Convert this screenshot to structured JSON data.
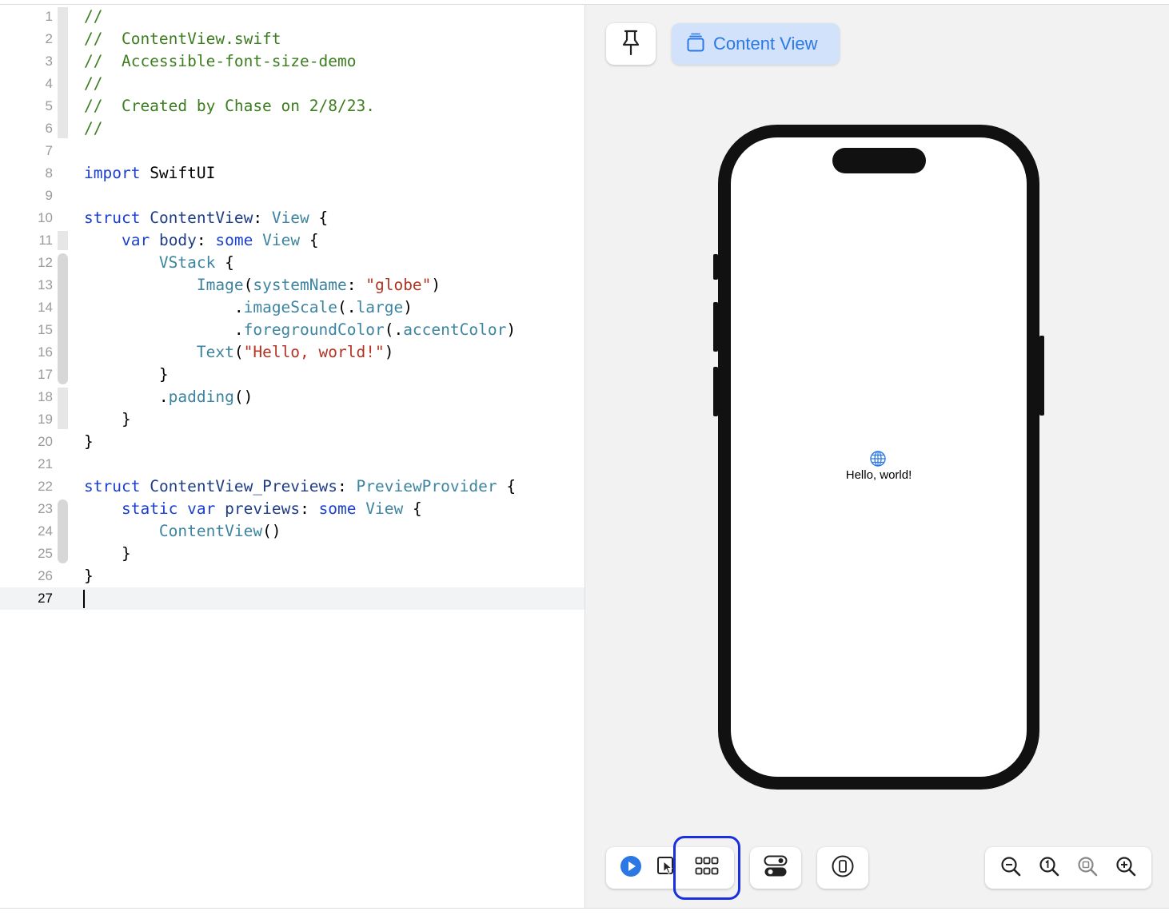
{
  "editor": {
    "lines": [
      {
        "num": "1",
        "tokens": [
          {
            "t": "//",
            "c": "comment"
          }
        ]
      },
      {
        "num": "2",
        "tokens": [
          {
            "t": "//  ContentView.swift",
            "c": "comment"
          }
        ]
      },
      {
        "num": "3",
        "tokens": [
          {
            "t": "//  Accessible-font-size-demo",
            "c": "comment"
          }
        ]
      },
      {
        "num": "4",
        "tokens": [
          {
            "t": "//",
            "c": "comment"
          }
        ]
      },
      {
        "num": "5",
        "tokens": [
          {
            "t": "//  Created by Chase on 2/8/23.",
            "c": "comment"
          }
        ]
      },
      {
        "num": "6",
        "tokens": [
          {
            "t": "//",
            "c": "comment"
          }
        ]
      },
      {
        "num": "7",
        "tokens": []
      },
      {
        "num": "8",
        "tokens": [
          {
            "t": "import",
            "c": "keyword"
          },
          {
            "t": " SwiftUI",
            "c": "plain"
          }
        ]
      },
      {
        "num": "9",
        "tokens": []
      },
      {
        "num": "10",
        "tokens": [
          {
            "t": "struct",
            "c": "keyword"
          },
          {
            "t": " ",
            "c": "plain"
          },
          {
            "t": "ContentView",
            "c": "decl"
          },
          {
            "t": ": ",
            "c": "plain"
          },
          {
            "t": "View",
            "c": "type"
          },
          {
            "t": " {",
            "c": "plain"
          }
        ]
      },
      {
        "num": "11",
        "tokens": [
          {
            "t": "    ",
            "c": "plain"
          },
          {
            "t": "var",
            "c": "keyword"
          },
          {
            "t": " ",
            "c": "plain"
          },
          {
            "t": "body",
            "c": "decl"
          },
          {
            "t": ": ",
            "c": "plain"
          },
          {
            "t": "some",
            "c": "keyword"
          },
          {
            "t": " ",
            "c": "plain"
          },
          {
            "t": "View",
            "c": "type"
          },
          {
            "t": " {",
            "c": "plain"
          }
        ]
      },
      {
        "num": "12",
        "tokens": [
          {
            "t": "        ",
            "c": "plain"
          },
          {
            "t": "VStack",
            "c": "type"
          },
          {
            "t": " {",
            "c": "plain"
          }
        ]
      },
      {
        "num": "13",
        "tokens": [
          {
            "t": "            ",
            "c": "plain"
          },
          {
            "t": "Image",
            "c": "type"
          },
          {
            "t": "(",
            "c": "plain"
          },
          {
            "t": "systemName",
            "c": "member"
          },
          {
            "t": ": ",
            "c": "plain"
          },
          {
            "t": "\"globe\"",
            "c": "string"
          },
          {
            "t": ")",
            "c": "plain"
          }
        ]
      },
      {
        "num": "14",
        "tokens": [
          {
            "t": "                .",
            "c": "plain"
          },
          {
            "t": "imageScale",
            "c": "member"
          },
          {
            "t": "(.",
            "c": "plain"
          },
          {
            "t": "large",
            "c": "member"
          },
          {
            "t": ")",
            "c": "plain"
          }
        ]
      },
      {
        "num": "15",
        "tokens": [
          {
            "t": "                .",
            "c": "plain"
          },
          {
            "t": "foregroundColor",
            "c": "member"
          },
          {
            "t": "(.",
            "c": "plain"
          },
          {
            "t": "accentColor",
            "c": "member"
          },
          {
            "t": ")",
            "c": "plain"
          }
        ]
      },
      {
        "num": "16",
        "tokens": [
          {
            "t": "            ",
            "c": "plain"
          },
          {
            "t": "Text",
            "c": "type"
          },
          {
            "t": "(",
            "c": "plain"
          },
          {
            "t": "\"Hello, world!\"",
            "c": "string"
          },
          {
            "t": ")",
            "c": "plain"
          }
        ]
      },
      {
        "num": "17",
        "tokens": [
          {
            "t": "        }",
            "c": "plain"
          }
        ]
      },
      {
        "num": "18",
        "tokens": [
          {
            "t": "        .",
            "c": "plain"
          },
          {
            "t": "padding",
            "c": "member"
          },
          {
            "t": "()",
            "c": "plain"
          }
        ]
      },
      {
        "num": "19",
        "tokens": [
          {
            "t": "    }",
            "c": "plain"
          }
        ]
      },
      {
        "num": "20",
        "tokens": [
          {
            "t": "}",
            "c": "plain"
          }
        ]
      },
      {
        "num": "21",
        "tokens": []
      },
      {
        "num": "22",
        "tokens": [
          {
            "t": "struct",
            "c": "keyword"
          },
          {
            "t": " ",
            "c": "plain"
          },
          {
            "t": "ContentView_Previews",
            "c": "decl"
          },
          {
            "t": ": ",
            "c": "plain"
          },
          {
            "t": "PreviewProvider",
            "c": "type"
          },
          {
            "t": " {",
            "c": "plain"
          }
        ]
      },
      {
        "num": "23",
        "tokens": [
          {
            "t": "    ",
            "c": "plain"
          },
          {
            "t": "static",
            "c": "keyword"
          },
          {
            "t": " ",
            "c": "plain"
          },
          {
            "t": "var",
            "c": "keyword"
          },
          {
            "t": " ",
            "c": "plain"
          },
          {
            "t": "previews",
            "c": "decl"
          },
          {
            "t": ": ",
            "c": "plain"
          },
          {
            "t": "some",
            "c": "keyword"
          },
          {
            "t": " ",
            "c": "plain"
          },
          {
            "t": "View",
            "c": "type"
          },
          {
            "t": " {",
            "c": "plain"
          }
        ]
      },
      {
        "num": "24",
        "tokens": [
          {
            "t": "        ",
            "c": "plain"
          },
          {
            "t": "ContentView",
            "c": "type"
          },
          {
            "t": "()",
            "c": "plain"
          }
        ]
      },
      {
        "num": "25",
        "tokens": [
          {
            "t": "    }",
            "c": "plain"
          }
        ]
      },
      {
        "num": "26",
        "tokens": [
          {
            "t": "}",
            "c": "plain"
          }
        ]
      },
      {
        "num": "27",
        "tokens": []
      }
    ],
    "current_line": "27"
  },
  "preview": {
    "pin_icon": "pin-icon",
    "content_view_icon": "stacked-views-icon",
    "content_view_label": "Content View",
    "device_text": "Hello, world!",
    "device_icon": "globe-icon",
    "toolbar": {
      "live_icon": "play-circle-icon",
      "select_icon": "cursor-select-icon",
      "variants_icon": "grid-variants-icon",
      "settings_icon": "toggle-settings-icon",
      "device_settings_icon": "device-settings-icon",
      "zoom_out_icon": "zoom-out-icon",
      "zoom_actual_icon": "zoom-actual-size-icon",
      "zoom_fit_icon": "zoom-to-fit-icon",
      "zoom_in_icon": "zoom-in-icon"
    }
  },
  "colors": {
    "comment": "#3c7d1f",
    "keyword": "#1a3fd0",
    "type": "#3d84a0",
    "string": "#b33323",
    "accent": "#2b78e4",
    "highlight_ring": "#1a2fe0"
  }
}
